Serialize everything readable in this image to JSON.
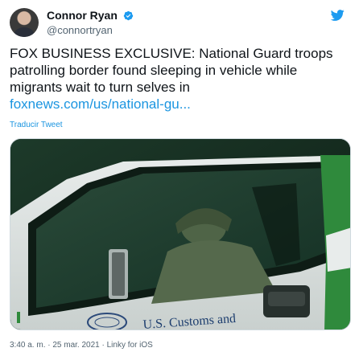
{
  "author": {
    "display_name": "Connor Ryan",
    "handle": "@connortryan",
    "verified": true
  },
  "tweet": {
    "text": "FOX BUSINESS EXCLUSIVE: National Guard troops patrolling border found sleeping in vehicle while migrants wait to turn selves in",
    "link": "foxnews.com/us/national-gu..."
  },
  "translate_label": "Traducir Tweet",
  "media": {
    "vehicle_text": "U.S. Customs and"
  },
  "meta": {
    "line": "3:40 a. m. · 25 mar. 2021 · Linky for iOS"
  },
  "colors": {
    "link": "#1b95e0",
    "verified": "#1d9bf0",
    "secondary_text": "#536471"
  },
  "icons": [
    "verified-badge-icon",
    "twitter-bird-icon"
  ]
}
